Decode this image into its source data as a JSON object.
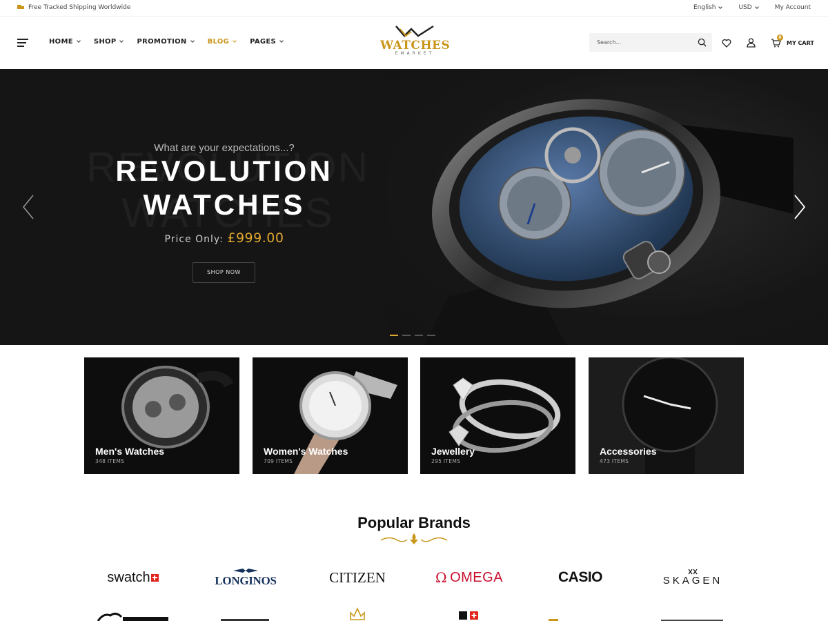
{
  "topbar": {
    "shipping": "Free Tracked Shipping Worldwide",
    "language": "English",
    "currency": "USD",
    "account": "My Account"
  },
  "header": {
    "nav": [
      {
        "label": "HOME"
      },
      {
        "label": "SHOP"
      },
      {
        "label": "PROMOTION"
      },
      {
        "label": "BLOG"
      },
      {
        "label": "PAGES"
      }
    ],
    "logo_word": "WATCHES",
    "logo_sub": "EMARKET",
    "search_placeholder": "Search...",
    "cart_label": "MY CART",
    "cart_count": "0"
  },
  "hero": {
    "kicker": "What are your expectations...?",
    "title_line1": "REVOLUTION",
    "title_line2": "WATCHES",
    "price_label": "Price Only:",
    "price": "£999.00",
    "cta": "SHOP NOW"
  },
  "categories": [
    {
      "name": "Men's Watches",
      "count": "348 ITEMS"
    },
    {
      "name": "Women's Watches",
      "count": "709 ITEMS"
    },
    {
      "name": "Jewellery",
      "count": "295 ITEMS"
    },
    {
      "name": "Accessories",
      "count": "473 ITEMS"
    }
  ],
  "brands": {
    "title": "Popular Brands",
    "items": [
      "swatch",
      "LONGINOS",
      "CITIZEN",
      "OMEGA",
      "CASIO",
      "SKAGEN"
    ]
  },
  "colors": {
    "accent": "#c9961a",
    "hero_bg": "#151515",
    "price": "#e0a82e"
  }
}
